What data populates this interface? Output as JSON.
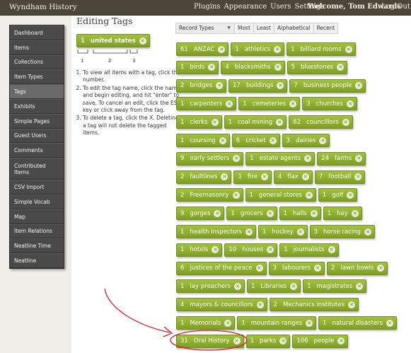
{
  "topbar": {
    "site_title": "Wyndham History",
    "nav": [
      "Plugins",
      "Appearance",
      "Users",
      "Settings"
    ],
    "welcome": "Welcome, Tom Edwards",
    "logout": "Log Out"
  },
  "sidebar": {
    "items": [
      {
        "label": "Dashboard"
      },
      {
        "label": "Items"
      },
      {
        "label": "Collections"
      },
      {
        "label": "Item Types"
      },
      {
        "label": "Tags",
        "active": true
      },
      {
        "label": "Exhibits"
      },
      {
        "label": "Simple Pages"
      },
      {
        "label": "Guest Users"
      },
      {
        "label": "Comments"
      },
      {
        "label": "Contributed Items"
      },
      {
        "label": "CSV Import"
      },
      {
        "label": "Simple Vocab"
      },
      {
        "label": "Map"
      },
      {
        "label": "Item Relations"
      },
      {
        "label": "Neatline Time"
      },
      {
        "label": "Neatline"
      }
    ]
  },
  "page": {
    "title": "Editing Tags",
    "example_tag": {
      "count": "1",
      "name": "united states"
    },
    "bracket_labels": [
      "1",
      "2",
      "3"
    ],
    "instructions": [
      "To view all items with a tag, click the number.",
      "To edit the tag name, click the name and begin editing, and hit \"enter\" to save. To cancel an edit, click the ESC key or click away from the tag.",
      "To delete a tag, click the X. Deleting a tag will not delete the tagged items."
    ]
  },
  "sort": {
    "select_label": "Record Types",
    "options": [
      "Most",
      "Least",
      "Alphabetical",
      "Recent"
    ]
  },
  "tag_rows": [
    [
      {
        "count": "61",
        "name": "ANZAC"
      },
      {
        "count": "1",
        "name": "athletics"
      },
      {
        "count": "1",
        "name": "billiard rooms"
      }
    ],
    [
      {
        "count": "1",
        "name": "birds"
      },
      {
        "count": "4",
        "name": "blacksmiths"
      },
      {
        "count": "5",
        "name": "bluestones"
      }
    ],
    [
      {
        "count": "2",
        "name": "bridges"
      },
      {
        "count": "17",
        "name": "buildings"
      },
      {
        "count": "7",
        "name": "business people"
      }
    ],
    [
      {
        "count": "1",
        "name": "carpenters"
      },
      {
        "count": "1",
        "name": "cemeteries"
      },
      {
        "count": "3",
        "name": "churches"
      }
    ],
    [
      {
        "count": "1",
        "name": "clerks"
      },
      {
        "count": "1",
        "name": "coal mining"
      },
      {
        "count": "62",
        "name": "councillors"
      }
    ],
    [
      {
        "count": "1",
        "name": "coursing"
      },
      {
        "count": "6",
        "name": "cricket"
      },
      {
        "count": "3",
        "name": "dairies"
      }
    ],
    [
      {
        "count": "9",
        "name": "early settlers"
      },
      {
        "count": "1",
        "name": "estate agents"
      },
      {
        "count": "24",
        "name": "farms"
      }
    ],
    [
      {
        "count": "2",
        "name": "faultlines"
      },
      {
        "count": "1",
        "name": "fire"
      },
      {
        "count": "4",
        "name": "flax"
      },
      {
        "count": "7",
        "name": "football"
      }
    ],
    [
      {
        "count": "2",
        "name": "Freemasonry"
      },
      {
        "count": "1",
        "name": "general stores"
      },
      {
        "count": "1",
        "name": "golf"
      }
    ],
    [
      {
        "count": "9",
        "name": "gorges"
      },
      {
        "count": "1",
        "name": "grocers"
      },
      {
        "count": "1",
        "name": "halls"
      },
      {
        "count": "1",
        "name": "hay"
      }
    ],
    [
      {
        "count": "1",
        "name": "health inspectors"
      },
      {
        "count": "1",
        "name": "hockey"
      },
      {
        "count": "3",
        "name": "horse racing"
      }
    ],
    [
      {
        "count": "1",
        "name": "hotels"
      },
      {
        "count": "10",
        "name": "houses"
      },
      {
        "count": "1",
        "name": "journalists"
      }
    ],
    [
      {
        "count": "6",
        "name": "justices of the peace"
      },
      {
        "count": "3",
        "name": "labourers"
      },
      {
        "count": "2",
        "name": "lawn bowls"
      }
    ],
    [
      {
        "count": "1",
        "name": "lay preachers"
      },
      {
        "count": "1",
        "name": "Libraries"
      },
      {
        "count": "1",
        "name": "magistrates"
      }
    ],
    [
      {
        "count": "4",
        "name": "mayors & councillors"
      },
      {
        "count": "2",
        "name": "Mechanics institutes"
      }
    ],
    [
      {
        "count": "1",
        "name": "Memorials"
      },
      {
        "count": "1",
        "name": "mountain ranges"
      },
      {
        "count": "1",
        "name": "natural disasters"
      }
    ],
    [
      {
        "count": "31",
        "name": "Oral History"
      },
      {
        "count": "1",
        "name": "parks"
      },
      {
        "count": "106",
        "name": "people"
      }
    ]
  ],
  "colors": {
    "topbar": "#4c4639",
    "sidebar": "#4a4a4a",
    "tag_green": "#8fb030",
    "annotation_red": "#d8202a"
  }
}
